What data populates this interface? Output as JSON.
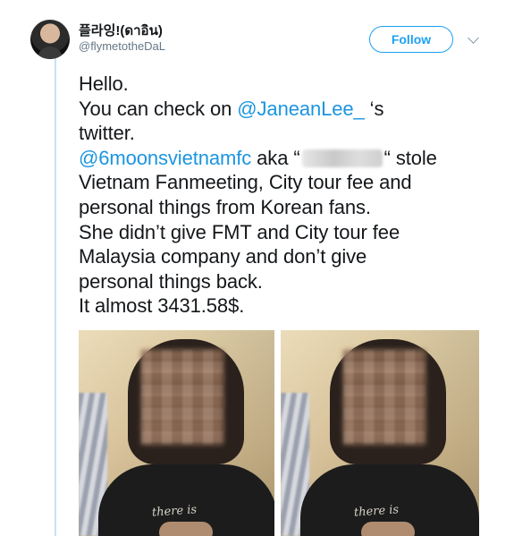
{
  "author": {
    "display_name": "플라잉!(ดาอิน)",
    "handle": "@flymetotheDaL"
  },
  "actions": {
    "follow_label": "Follow",
    "menu_icon": "chevron-down-icon"
  },
  "tweet": {
    "line1": "Hello.",
    "line2_prefix": "You can check on ",
    "line2_mention": "@JaneanLee_",
    "line2_suffix": " ‘s",
    "line3": "twitter.",
    "line4_mention": "@6moonsvietnamfc",
    "line4_before_redaction": " aka “",
    "line4_after_redaction": "“ stole",
    "line5": "Vietnam Fanmeeting, City tour fee and",
    "line6": "personal things from Korean fans.",
    "line7": "She didn’t give FMT and City tour fee",
    "line8": "Malaysia company and don’t give",
    "line9": "personal things back.",
    "line10": "It almost 3431.58$."
  },
  "media": {
    "photo_1_shirt_text": "there is",
    "photo_2_shirt_text": "there is"
  },
  "colors": {
    "accent": "#1da1f2",
    "mention": "#1b95e0",
    "text": "#14171a",
    "secondary": "#657786"
  }
}
